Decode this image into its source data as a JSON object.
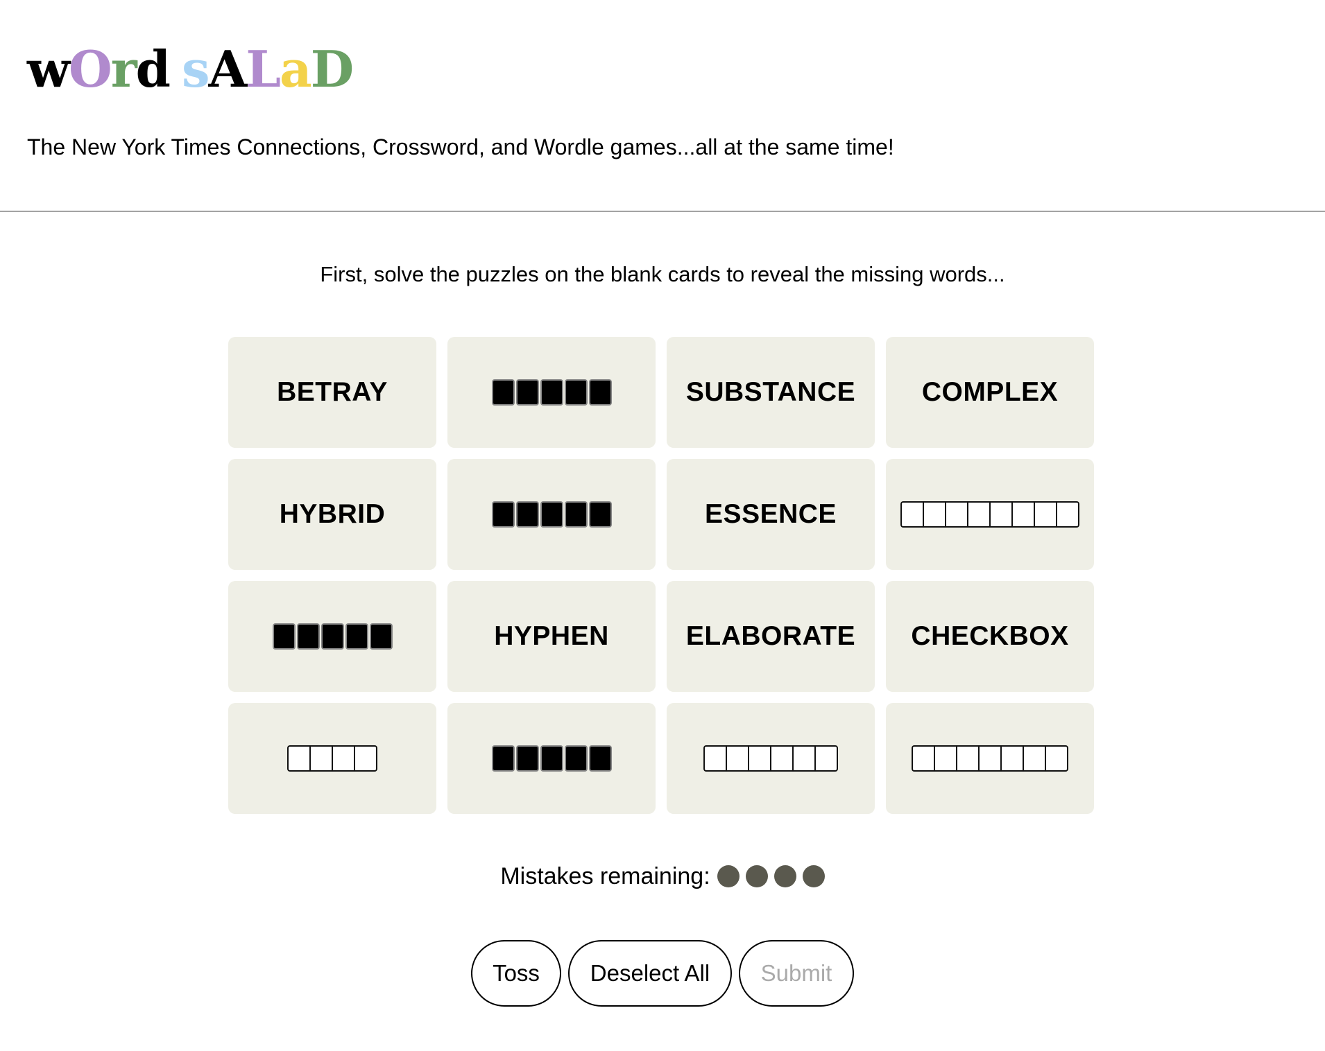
{
  "logo": {
    "letters": [
      {
        "char": "w",
        "color": "#000000"
      },
      {
        "char": "O",
        "color": "#b08acd"
      },
      {
        "char": "r",
        "color": "#6aa064"
      },
      {
        "char": "d",
        "color": "#000000"
      },
      {
        "char": "s",
        "color": "#a8d3f5"
      },
      {
        "char": "A",
        "color": "#000000"
      },
      {
        "char": "L",
        "color": "#b08acd"
      },
      {
        "char": "a",
        "color": "#f3d24a"
      },
      {
        "char": "D",
        "color": "#6aa064"
      }
    ]
  },
  "tagline": "The New York Times Connections, Crossword, and Wordle games...all at the same time!",
  "intro": "First, solve the puzzles on the blank cards to reveal the missing words...",
  "cards": [
    {
      "type": "word",
      "text": "BETRAY"
    },
    {
      "type": "hidden",
      "length": 5
    },
    {
      "type": "word",
      "text": "SUBSTANCE"
    },
    {
      "type": "word",
      "text": "COMPLEX"
    },
    {
      "type": "word",
      "text": "HYBRID"
    },
    {
      "type": "hidden",
      "length": 5
    },
    {
      "type": "word",
      "text": "ESSENCE"
    },
    {
      "type": "blank",
      "length": 8
    },
    {
      "type": "hidden",
      "length": 5
    },
    {
      "type": "word",
      "text": "HYPHEN"
    },
    {
      "type": "word",
      "text": "ELABORATE"
    },
    {
      "type": "word",
      "text": "CHECKBOX"
    },
    {
      "type": "blank",
      "length": 4
    },
    {
      "type": "hidden",
      "length": 5
    },
    {
      "type": "blank",
      "length": 6
    },
    {
      "type": "blank",
      "length": 7
    }
  ],
  "mistakes": {
    "label": "Mistakes remaining:",
    "remaining": 4,
    "dot_color": "#5a594e"
  },
  "buttons": {
    "toss": "Toss",
    "deselect_all": "Deselect All",
    "submit": "Submit"
  }
}
